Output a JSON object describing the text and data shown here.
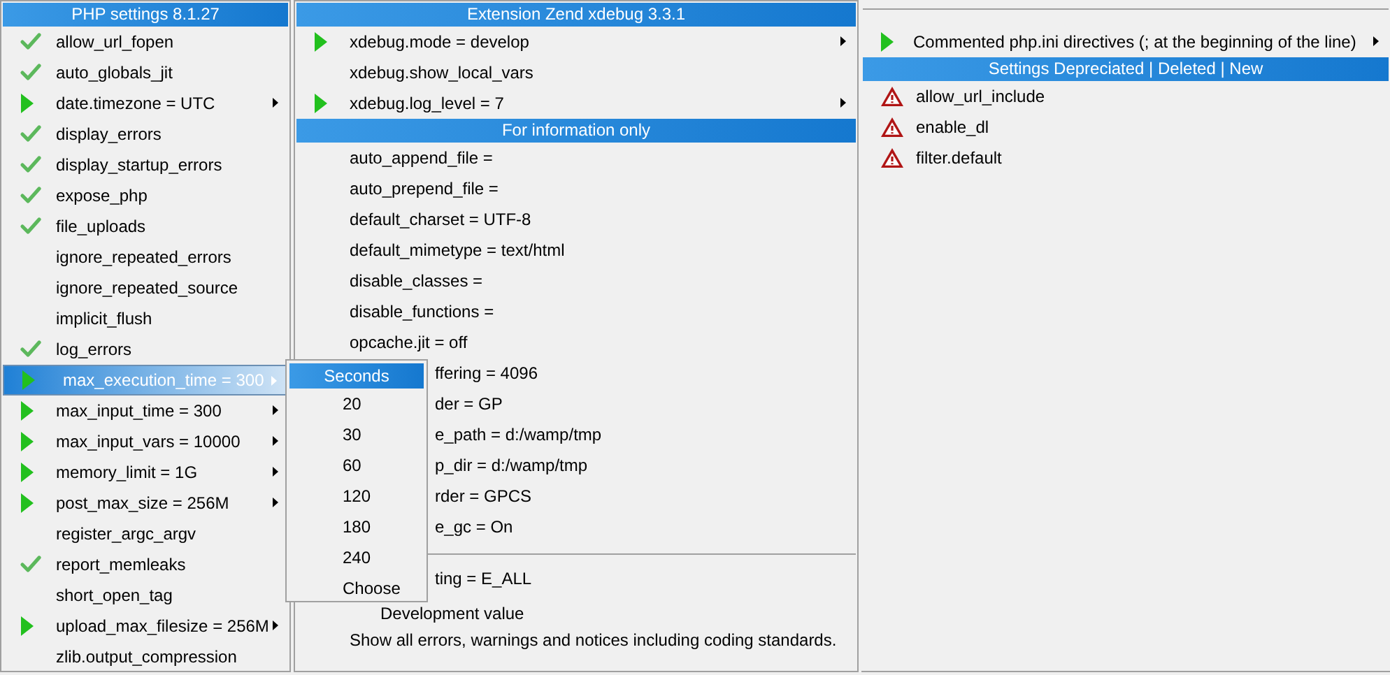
{
  "php_settings": {
    "title": "PHP settings 8.1.27",
    "items": [
      {
        "label": "allow_url_fopen",
        "kind": "check",
        "submenu": false,
        "selected": false
      },
      {
        "label": "auto_globals_jit",
        "kind": "check",
        "submenu": false,
        "selected": false
      },
      {
        "label": "date.timezone = UTC",
        "kind": "arrow",
        "submenu": true,
        "selected": false
      },
      {
        "label": "display_errors",
        "kind": "check",
        "submenu": false,
        "selected": false
      },
      {
        "label": "display_startup_errors",
        "kind": "check",
        "submenu": false,
        "selected": false
      },
      {
        "label": "expose_php",
        "kind": "check",
        "submenu": false,
        "selected": false
      },
      {
        "label": "file_uploads",
        "kind": "check",
        "submenu": false,
        "selected": false
      },
      {
        "label": "ignore_repeated_errors",
        "kind": "none",
        "submenu": false,
        "selected": false
      },
      {
        "label": "ignore_repeated_source",
        "kind": "none",
        "submenu": false,
        "selected": false
      },
      {
        "label": "implicit_flush",
        "kind": "none",
        "submenu": false,
        "selected": false
      },
      {
        "label": "log_errors",
        "kind": "check",
        "submenu": false,
        "selected": false
      },
      {
        "label": "max_execution_time = 300",
        "kind": "arrow",
        "submenu": true,
        "selected": true
      },
      {
        "label": "max_input_time = 300",
        "kind": "arrow",
        "submenu": true,
        "selected": false
      },
      {
        "label": "max_input_vars = 10000",
        "kind": "arrow",
        "submenu": true,
        "selected": false
      },
      {
        "label": "memory_limit = 1G",
        "kind": "arrow",
        "submenu": true,
        "selected": false
      },
      {
        "label": "post_max_size = 256M",
        "kind": "arrow",
        "submenu": true,
        "selected": false
      },
      {
        "label": "register_argc_argv",
        "kind": "none",
        "submenu": false,
        "selected": false
      },
      {
        "label": "report_memleaks",
        "kind": "check",
        "submenu": false,
        "selected": false
      },
      {
        "label": "short_open_tag",
        "kind": "none",
        "submenu": false,
        "selected": false
      },
      {
        "label": "upload_max_filesize = 256M",
        "kind": "arrow",
        "submenu": true,
        "selected": false
      },
      {
        "label": "zlib.output_compression",
        "kind": "none",
        "submenu": false,
        "selected": false
      }
    ]
  },
  "xdebug": {
    "title": "Extension Zend xdebug 3.3.1",
    "items": [
      {
        "label": "xdebug.mode = develop",
        "kind": "arrow",
        "submenu": true
      },
      {
        "label": "xdebug.show_local_vars",
        "kind": "none",
        "submenu": false
      },
      {
        "label": "xdebug.log_level = 7",
        "kind": "arrow",
        "submenu": true
      }
    ]
  },
  "information": {
    "title": "For information only",
    "items": [
      {
        "label": "auto_append_file =",
        "partly_hidden": false
      },
      {
        "label": "auto_prepend_file =",
        "partly_hidden": false
      },
      {
        "label": "default_charset = UTF-8",
        "partly_hidden": false
      },
      {
        "label": "default_mimetype = text/html",
        "partly_hidden": false
      },
      {
        "label": "disable_classes =",
        "partly_hidden": false
      },
      {
        "label": "disable_functions =",
        "partly_hidden": false
      },
      {
        "label": "opcache.jit = off",
        "partly_hidden": false
      },
      {
        "label": "ffering = 4096",
        "partly_hidden": true
      },
      {
        "label": "der = GP",
        "partly_hidden": true
      },
      {
        "label": "e_path = d:/wamp/tmp",
        "partly_hidden": true
      },
      {
        "label": "p_dir = d:/wamp/tmp",
        "partly_hidden": true
      },
      {
        "label": "rder = GPCS",
        "partly_hidden": true
      },
      {
        "label": "e_gc = On",
        "partly_hidden": true
      }
    ],
    "error_reporting": {
      "label": "ting = E_ALL",
      "note": "Development value",
      "description": "Show all errors, warnings and notices including coding standards."
    }
  },
  "commented": {
    "label": "Commented php.ini directives (; at the beginning of the line)",
    "kind": "arrow",
    "submenu": true
  },
  "deprecated": {
    "title": "Settings Depreciated | Deleted | New",
    "items": [
      "allow_url_include",
      "enable_dl",
      "filter.default"
    ]
  },
  "seconds_menu": {
    "items": [
      {
        "label": "Seconds",
        "selected": true
      },
      {
        "label": "20",
        "selected": false
      },
      {
        "label": "30",
        "selected": false
      },
      {
        "label": "60",
        "selected": false
      },
      {
        "label": "120",
        "selected": false
      },
      {
        "label": "180",
        "selected": false
      },
      {
        "label": "240",
        "selected": false
      },
      {
        "label": "Choose",
        "selected": false
      }
    ]
  }
}
